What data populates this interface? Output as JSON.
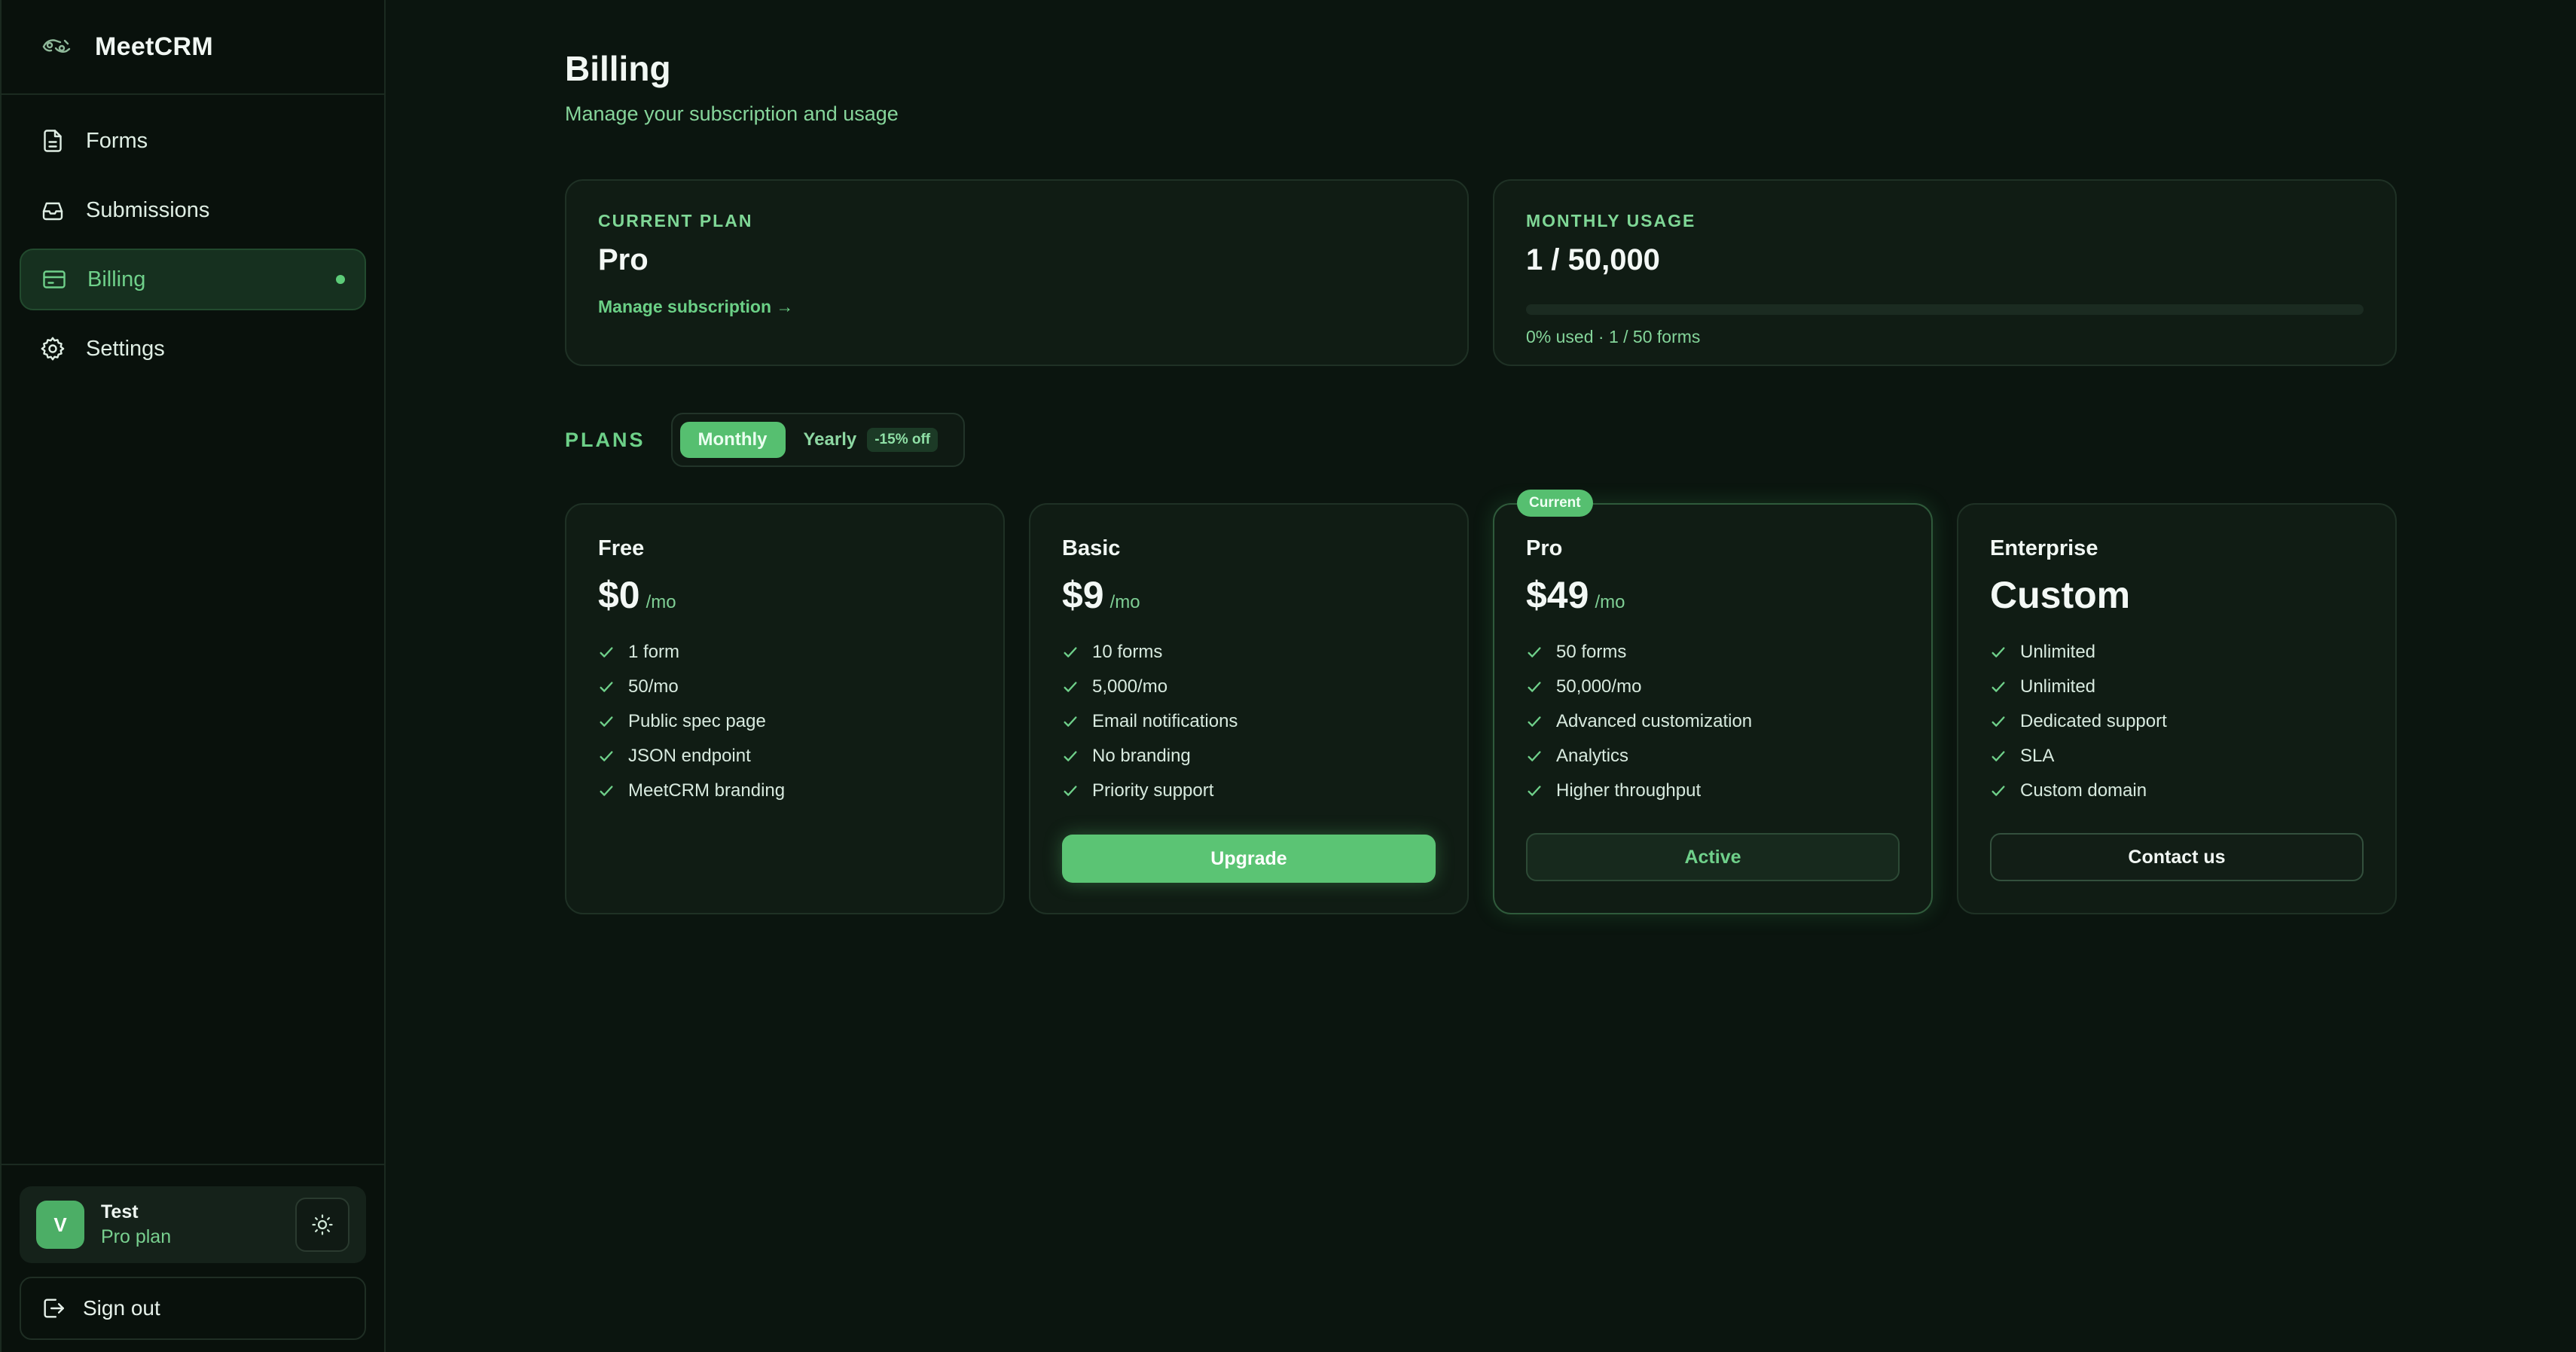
{
  "app": {
    "name": "MeetCRM"
  },
  "sidebar": {
    "items": [
      {
        "label": "Forms",
        "icon": "document-icon"
      },
      {
        "label": "Submissions",
        "icon": "inbox-icon"
      },
      {
        "label": "Billing",
        "icon": "credit-card-icon",
        "active": true
      },
      {
        "label": "Settings",
        "icon": "gear-icon"
      }
    ]
  },
  "user": {
    "initial": "V",
    "name": "Test",
    "plan": "Pro plan"
  },
  "signout": {
    "label": "Sign out"
  },
  "page": {
    "title": "Billing",
    "subtitle": "Manage your subscription and usage"
  },
  "current_plan": {
    "eyebrow": "CURRENT PLAN",
    "name": "Pro",
    "manage_link": "Manage subscription →"
  },
  "usage": {
    "eyebrow": "MONTHLY USAGE",
    "value": "1 / 50,000",
    "percent_used": 0,
    "note": "0% used · 1 / 50 forms"
  },
  "plans": {
    "label": "PLANS",
    "toggle": {
      "monthly": "Monthly",
      "yearly": "Yearly",
      "discount": "-15% off",
      "selected": "Monthly"
    },
    "tiers": [
      {
        "name": "Free",
        "price": "$0",
        "period": "/mo",
        "features": [
          "1 form",
          "50/mo",
          "Public spec page",
          "JSON endpoint",
          "MeetCRM branding"
        ],
        "button": ""
      },
      {
        "name": "Basic",
        "price": "$9",
        "period": "/mo",
        "features": [
          "10 forms",
          "5,000/mo",
          "Email notifications",
          "No branding",
          "Priority support"
        ],
        "button": "Upgrade"
      },
      {
        "name": "Pro",
        "price": "$49",
        "period": "/mo",
        "badge": "Current",
        "features": [
          "50 forms",
          "50,000/mo",
          "Advanced customization",
          "Analytics",
          "Higher throughput"
        ],
        "button": "Active"
      },
      {
        "name": "Enterprise",
        "price": "Custom",
        "period": "",
        "features": [
          "Unlimited",
          "Unlimited",
          "Dedicated support",
          "SLA",
          "Custom domain"
        ],
        "button": "Contact us"
      }
    ]
  },
  "colors": {
    "accent": "#5ccb78",
    "background": "#0b150f",
    "card": "#101c14"
  }
}
